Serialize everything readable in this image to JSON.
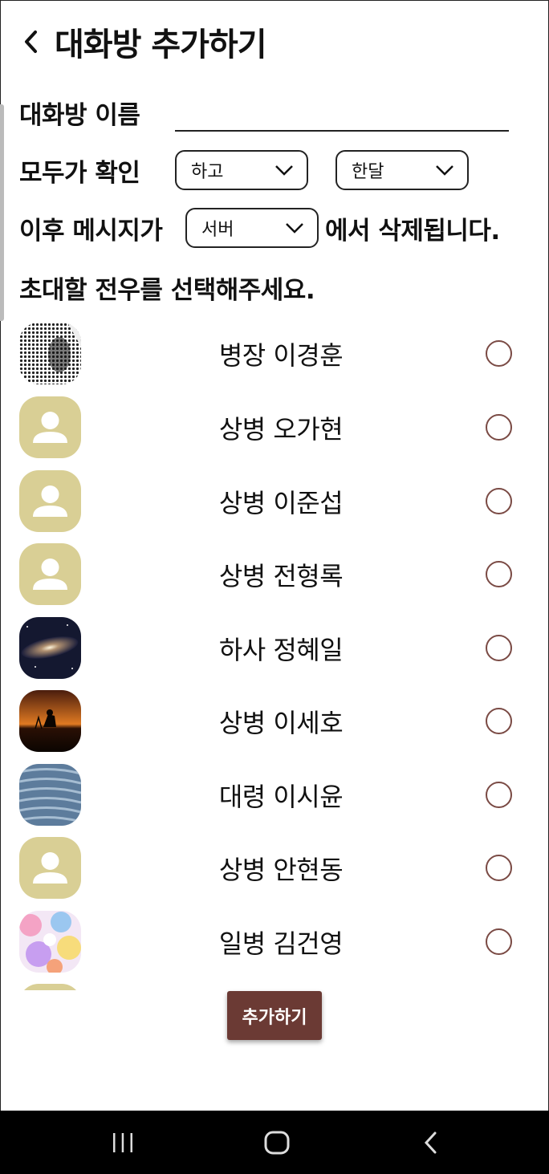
{
  "header": {
    "title": "대화방 추가하기"
  },
  "form": {
    "room_name_label": "대화방 이름",
    "room_name_value": "",
    "confirm_label": "모두가 확인",
    "confirm_select": "하고",
    "period_select": "한달",
    "after_label": "이후 메시지가",
    "location_select": "서버",
    "deleted_suffix": "에서 삭제됩니다.",
    "invite_prompt": "초대할 전우를 선택해주세요."
  },
  "members": [
    {
      "name": "병장 이경훈",
      "avatar": "pattern-photo",
      "selected": false
    },
    {
      "name": "상병 오가현",
      "avatar": "default-person-icon",
      "selected": false
    },
    {
      "name": "상병 이준섭",
      "avatar": "default-person-icon",
      "selected": false
    },
    {
      "name": "상병 전형록",
      "avatar": "default-person-icon",
      "selected": false
    },
    {
      "name": "하사 정혜일",
      "avatar": "galaxy-photo",
      "selected": false
    },
    {
      "name": "상병 이세호",
      "avatar": "sunset-photo",
      "selected": false
    },
    {
      "name": "대령 이시윤",
      "avatar": "fabric-photo",
      "selected": false
    },
    {
      "name": "상병 안현동",
      "avatar": "default-person-icon",
      "selected": false
    },
    {
      "name": "일병 김건영",
      "avatar": "colorful-photo",
      "selected": false
    }
  ],
  "actions": {
    "add_label": "추가하기"
  },
  "navbar": {
    "recent": "recent-apps-icon",
    "home": "home-icon",
    "back": "back-icon"
  },
  "colors": {
    "accent": "#6b3a34",
    "radio": "#7a4a44",
    "default_avatar": "#d9cf95"
  }
}
